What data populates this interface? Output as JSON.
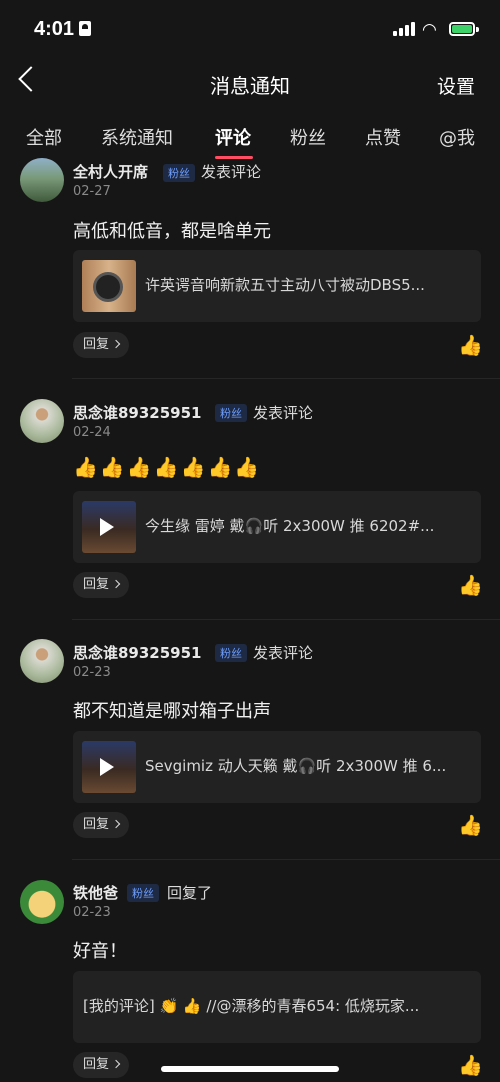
{
  "status": {
    "time": "4:01"
  },
  "nav": {
    "title": "消息通知",
    "settings": "设置"
  },
  "tabs": [
    {
      "label": "全部"
    },
    {
      "label": "系统通知"
    },
    {
      "label": "评论",
      "active": true
    },
    {
      "label": "粉丝"
    },
    {
      "label": "点赞"
    },
    {
      "label": "@我"
    }
  ],
  "items": [
    {
      "name": "全村人开席",
      "badge": "粉丝",
      "action": "发表评论",
      "date": "02-27",
      "comment": "高低和低音，都是啥单元",
      "card_text": "许英谔音响新款五寸主动八寸被动DBS5...",
      "reply": "回复",
      "liked": true
    },
    {
      "name": "思念谁89325951",
      "badge": "粉丝",
      "action": "发表评论",
      "date": "02-24",
      "comment": "👍👍👍👍👍👍👍",
      "card_text": "今生缘 雷婷 戴🎧听 2x300W 推 6202#...",
      "reply": "回复",
      "liked": false
    },
    {
      "name": "思念谁89325951",
      "badge": "粉丝",
      "action": "发表评论",
      "date": "02-23",
      "comment": "都不知道是哪对箱子出声",
      "card_text": "Sevgimiz 动人天籁 戴🎧听 2x300W 推 6...",
      "reply": "回复",
      "liked": true
    },
    {
      "name": "铁他爸",
      "badge": "粉丝",
      "action": "回复了",
      "date": "02-23",
      "comment": "好音！",
      "card_text": "[我的评论] 👏 👍 //@漂移的青春654: 低烧玩家...",
      "reply": "回复",
      "liked": true
    }
  ],
  "icons": {
    "liked_color": "#ff5b66",
    "badge_color": "#6e9fff"
  }
}
